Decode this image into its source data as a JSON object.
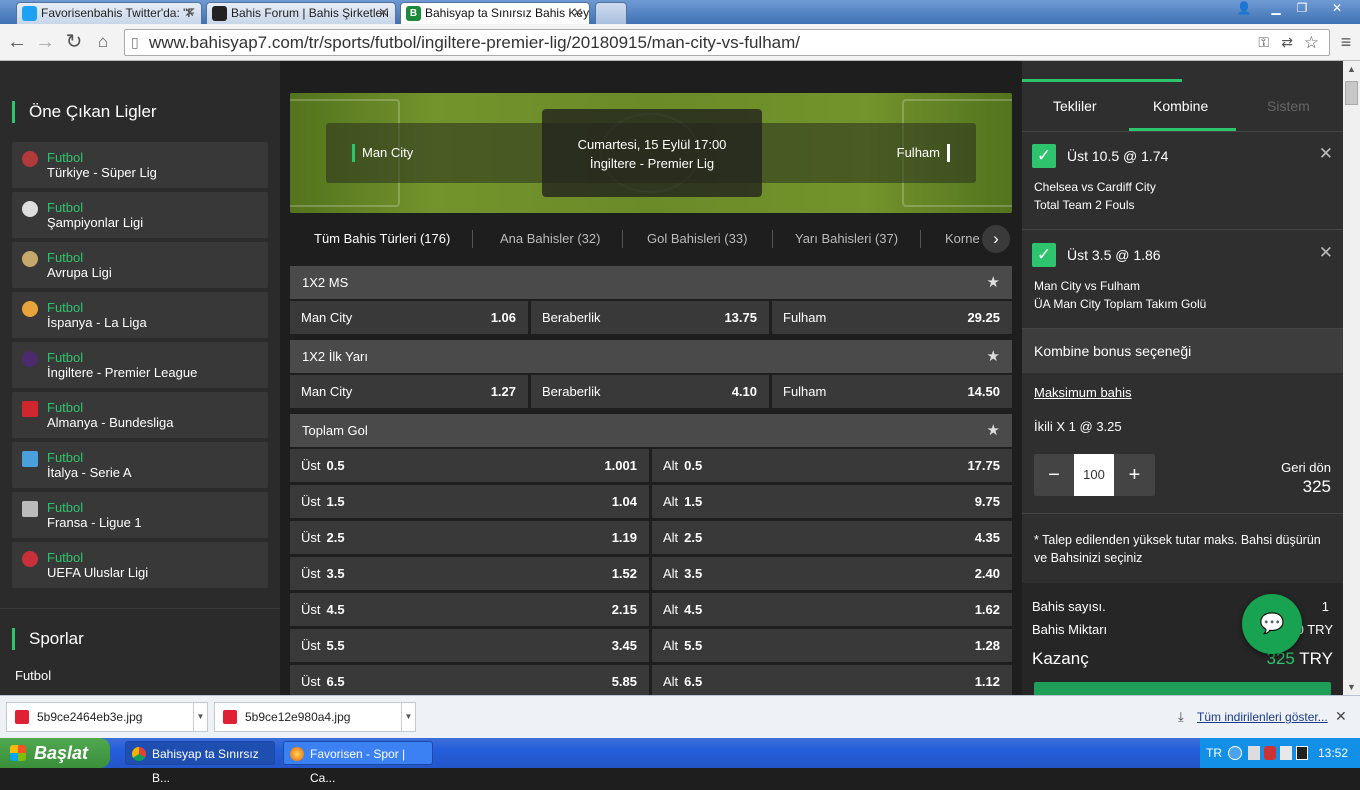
{
  "browser": {
    "tabs": [
      {
        "label": "Favorisenbahis Twitter'da: \"F",
        "fav_color": "#1da1f2"
      },
      {
        "label": "Bahis Forum | Bahis Şirketleri",
        "fav_color": "#222222"
      },
      {
        "label": "Bahisyap ta Sınırsız Bahis Key",
        "fav_color": "#1b8a3b"
      }
    ],
    "url": "www.bahisyap7.com/tr/sports/futbol/ingiltere-premier-lig/20180915/man-city-vs-fulham/"
  },
  "sidebar": {
    "featured_title": "Öne Çıkan Ligler",
    "leagues": [
      {
        "sport": "Futbol",
        "name": "Türkiye - Süper Lig"
      },
      {
        "sport": "Futbol",
        "name": "Şampiyonlar Ligi"
      },
      {
        "sport": "Futbol",
        "name": "Avrupa Ligi"
      },
      {
        "sport": "Futbol",
        "name": "İspanya - La Liga"
      },
      {
        "sport": "Futbol",
        "name": "İngiltere - Premier League"
      },
      {
        "sport": "Futbol",
        "name": "Almanya - Bundesliga"
      },
      {
        "sport": "Futbol",
        "name": "İtalya - Serie A"
      },
      {
        "sport": "Futbol",
        "name": "Fransa - Ligue 1"
      },
      {
        "sport": "Futbol",
        "name": "UEFA Uluslar Ligi"
      }
    ],
    "sports_title": "Sporlar",
    "sports": [
      "Futbol"
    ]
  },
  "match": {
    "home": "Man City",
    "away": "Fulham",
    "datetime": "Cumartesi, 15 Eylül 17:00",
    "competition": "İngiltere - Premier Lig"
  },
  "market_tabs": [
    "Tüm Bahis Türleri (176)",
    "Ana Bahisler (32)",
    "Gol Bahisleri (33)",
    "Yarı Bahisleri (37)",
    "Korne"
  ],
  "markets": {
    "ms": {
      "title": "1X2 MS",
      "odds": [
        {
          "label": "Man City",
          "value": "1.06"
        },
        {
          "label": "Beraberlik",
          "value": "13.75"
        },
        {
          "label": "Fulham",
          "value": "29.25"
        }
      ]
    },
    "ht": {
      "title": "1X2 İlk Yarı",
      "odds": [
        {
          "label": "Man City",
          "value": "1.27"
        },
        {
          "label": "Beraberlik",
          "value": "4.10"
        },
        {
          "label": "Fulham",
          "value": "14.50"
        }
      ]
    },
    "total": {
      "title": "Toplam Gol",
      "over_label": "Üst",
      "under_label": "Alt",
      "rows": [
        {
          "line": "0.5",
          "over": "1.001",
          "under": "17.75"
        },
        {
          "line": "1.5",
          "over": "1.04",
          "under": "9.75"
        },
        {
          "line": "2.5",
          "over": "1.19",
          "under": "4.35"
        },
        {
          "line": "3.5",
          "over": "1.52",
          "under": "2.40"
        },
        {
          "line": "4.5",
          "over": "2.15",
          "under": "1.62"
        },
        {
          "line": "5.5",
          "over": "3.45",
          "under": "1.28"
        },
        {
          "line": "6.5",
          "over": "5.85",
          "under": "1.12"
        }
      ]
    }
  },
  "slip": {
    "tabs": [
      "Tekliler",
      "Kombine",
      "Sistem"
    ],
    "picks": [
      {
        "selection": "Üst  10.5 @ 1.74",
        "match": "Chelsea  vs  Cardiff City",
        "market": "Total Team 2 Fouls"
      },
      {
        "selection": "Üst  3.5 @ 1.86",
        "match": "Man City  vs  Fulham",
        "market": "ÜA Man City Toplam Takım Golü"
      }
    ],
    "bonus_label": "Kombine bonus seçeneği",
    "max_bet": "Maksimum bahis",
    "combo_line": "İkili X  1 @  3.25",
    "stake": "100",
    "return_label": "Geri dön",
    "return_value": "325",
    "note": "*  Talep edilenden yüksek tutar maks. Bahsi düşürün ve Bahsinizi seçiniz",
    "count_label": "Bahis sayısı.",
    "count_value": "1",
    "amount_label": "Bahis Miktarı",
    "amount_value": "0 TRY",
    "win_label": "Kazanç",
    "win_value": "325",
    "win_currency": "TRY"
  },
  "downloads": {
    "items": [
      "5b9ce2464eb3e.jpg",
      "5b9ce12e980a4.jpg"
    ],
    "show_all": "Tüm indirilenleri göster..."
  },
  "taskbar": {
    "start": "Başlat",
    "tasks": [
      "Bahisyap ta Sınırsız B...",
      "Favorisen - Spor | Ca..."
    ],
    "lang": "TR",
    "clock": "13:52"
  },
  "colors": {
    "accent": "#2ec46e",
    "slip_bg": "#2f2f2f"
  }
}
